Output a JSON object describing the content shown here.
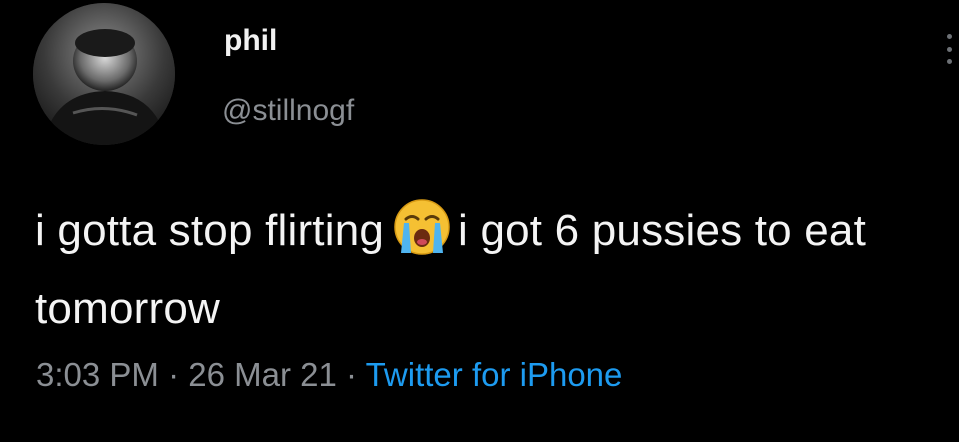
{
  "user": {
    "display_name": "phil",
    "handle": "@stillnogf"
  },
  "tweet": {
    "text_part1": "i gotta stop flirting",
    "emoji": "loudly-crying-face",
    "text_part2": "i got 6 pussies to eat tomorrow"
  },
  "meta": {
    "time": "3:03 PM",
    "separator": "·",
    "date": "26 Mar 21",
    "source": "Twitter for iPhone"
  },
  "icons": {
    "more": "more-vertical-icon",
    "avatar": "avatar"
  },
  "colors": {
    "background": "#000000",
    "text": "#f4f4f4",
    "secondary": "#8b8f94",
    "link": "#1d9bf0"
  }
}
